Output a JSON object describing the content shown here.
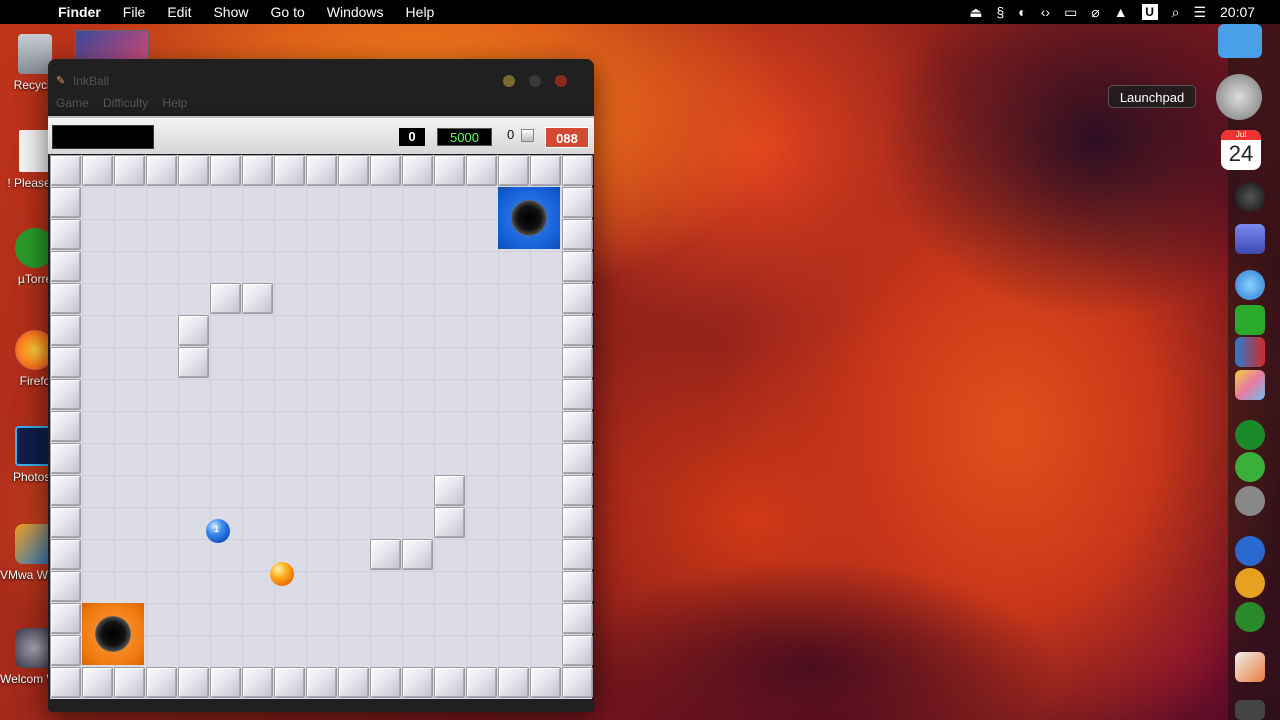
{
  "menubar": {
    "app_name": "Finder",
    "items": [
      "File",
      "Edit",
      "Show",
      "Go to",
      "Windows",
      "Help"
    ],
    "status_icons": [
      "eject-icon",
      "script-icon",
      "half-circle-icon",
      "code-icon",
      "display-icon",
      "no-wifi-icon",
      "eject-alt-icon",
      "u-icon",
      "search-icon",
      "control-center-icon"
    ],
    "clock": "20:07"
  },
  "desktop_icons": [
    {
      "label": "Recycle",
      "color": "#9aa0a8"
    },
    {
      "label": "! Please R",
      "color": "#f0f0f0"
    },
    {
      "label": "µTorre",
      "color": "#2a9a2a"
    },
    {
      "label": "Firefo",
      "color": "#ff7a1a"
    },
    {
      "label": "Photosh",
      "color": "#1a2a6a"
    },
    {
      "label": "VMwa Workstat",
      "color": "#2a7ad0"
    },
    {
      "label": "Welcom Window",
      "color": "#3a3a5a"
    }
  ],
  "dock": {
    "tooltip": "Launchpad",
    "calendar_month": "Jul",
    "calendar_day": "24",
    "items": [
      {
        "name": "finder-icon",
        "color": "#4aa0e8"
      },
      {
        "name": "launchpad-icon",
        "color": "#888"
      },
      {
        "name": "calendar-icon",
        "color": "#fff"
      },
      {
        "name": "clock-icon",
        "color": "#333"
      },
      {
        "name": "screen-icon",
        "color": "#5a6ad0"
      },
      {
        "name": "safari-icon",
        "color": "#3a9af0"
      },
      {
        "name": "utorrent-icon",
        "color": "#2aaa2a"
      },
      {
        "name": "parallels-icon",
        "color": "#2a7ad0"
      },
      {
        "name": "photos-icon",
        "color": "#e8a0c0"
      },
      {
        "name": "collabsoft-icon",
        "color": "#1a8a2a"
      },
      {
        "name": "link-icon",
        "color": "#3ab03a"
      },
      {
        "name": "tools-icon",
        "color": "#777"
      },
      {
        "name": "www-icon",
        "color": "#2a6ad0"
      },
      {
        "name": "download-icon",
        "color": "#e8a020"
      },
      {
        "name": "network-icon",
        "color": "#2a8a2a"
      },
      {
        "name": "inkball-icon",
        "color": "#c0c0c0"
      },
      {
        "name": "trash-icon",
        "color": "#555"
      }
    ]
  },
  "inkball": {
    "title": "InkBall",
    "menus": [
      "Game",
      "Difficulty",
      "Help"
    ],
    "score_left": "0",
    "score_points": "5000",
    "balls_count": "0",
    "timer": "088",
    "wall_tiles": [
      [
        9,
        1
      ],
      [
        9,
        2
      ],
      [
        5,
        3
      ],
      [
        6,
        3
      ],
      [
        4,
        4
      ],
      [
        4,
        5
      ],
      [
        12,
        10
      ],
      [
        12,
        11
      ],
      [
        10,
        12
      ],
      [
        11,
        12
      ]
    ],
    "holes": [
      {
        "color": "blue",
        "col": 14,
        "row": 1
      },
      {
        "color": "orange",
        "col": 1,
        "row": 14
      }
    ],
    "balls": [
      {
        "color": "blue",
        "label": "1"
      },
      {
        "color": "orange",
        "label": ""
      }
    ]
  }
}
